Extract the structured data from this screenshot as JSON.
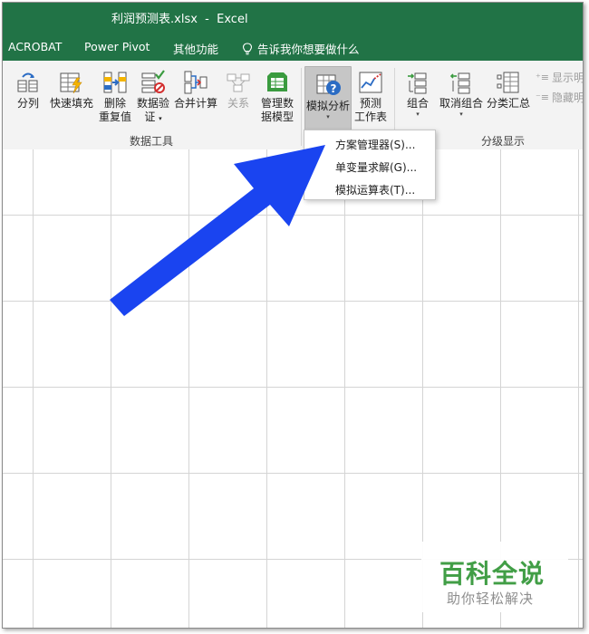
{
  "window": {
    "title": "利润预测表.xlsx  -  Excel"
  },
  "tabs": {
    "acrobat": "ACROBAT",
    "power_pivot": "Power Pivot",
    "other": "其他功能",
    "tell_me": "告诉我你想要做什么"
  },
  "ribbon": {
    "split": "分列",
    "flash_fill": "快速填充",
    "remove_dup_1": "删除",
    "remove_dup_2": "重复值",
    "validation_1": "数据验",
    "validation_2": "证",
    "consolidate": "合并计算",
    "relations": "关系",
    "data_model_1": "管理数",
    "data_model_2": "据模型",
    "what_if": "模拟分析",
    "forecast_1": "预测",
    "forecast_2": "工作表",
    "group": "组合",
    "ungroup": "取消组合",
    "subtotal": "分类汇总",
    "show_detail": "显示明",
    "hide_detail": "隐藏明",
    "group_data_tools": "数据工具",
    "group_outline": "分级显示"
  },
  "menu": {
    "items": [
      "方案管理器(S)...",
      "单变量求解(G)...",
      "模拟运算表(T)..."
    ]
  },
  "watermark": {
    "title": "百科全说",
    "subtitle": "助你轻松解决"
  },
  "colors": {
    "excel_green": "#217346",
    "arrow_blue": "#1a44f0",
    "watermark_green": "#3a9b3f"
  }
}
